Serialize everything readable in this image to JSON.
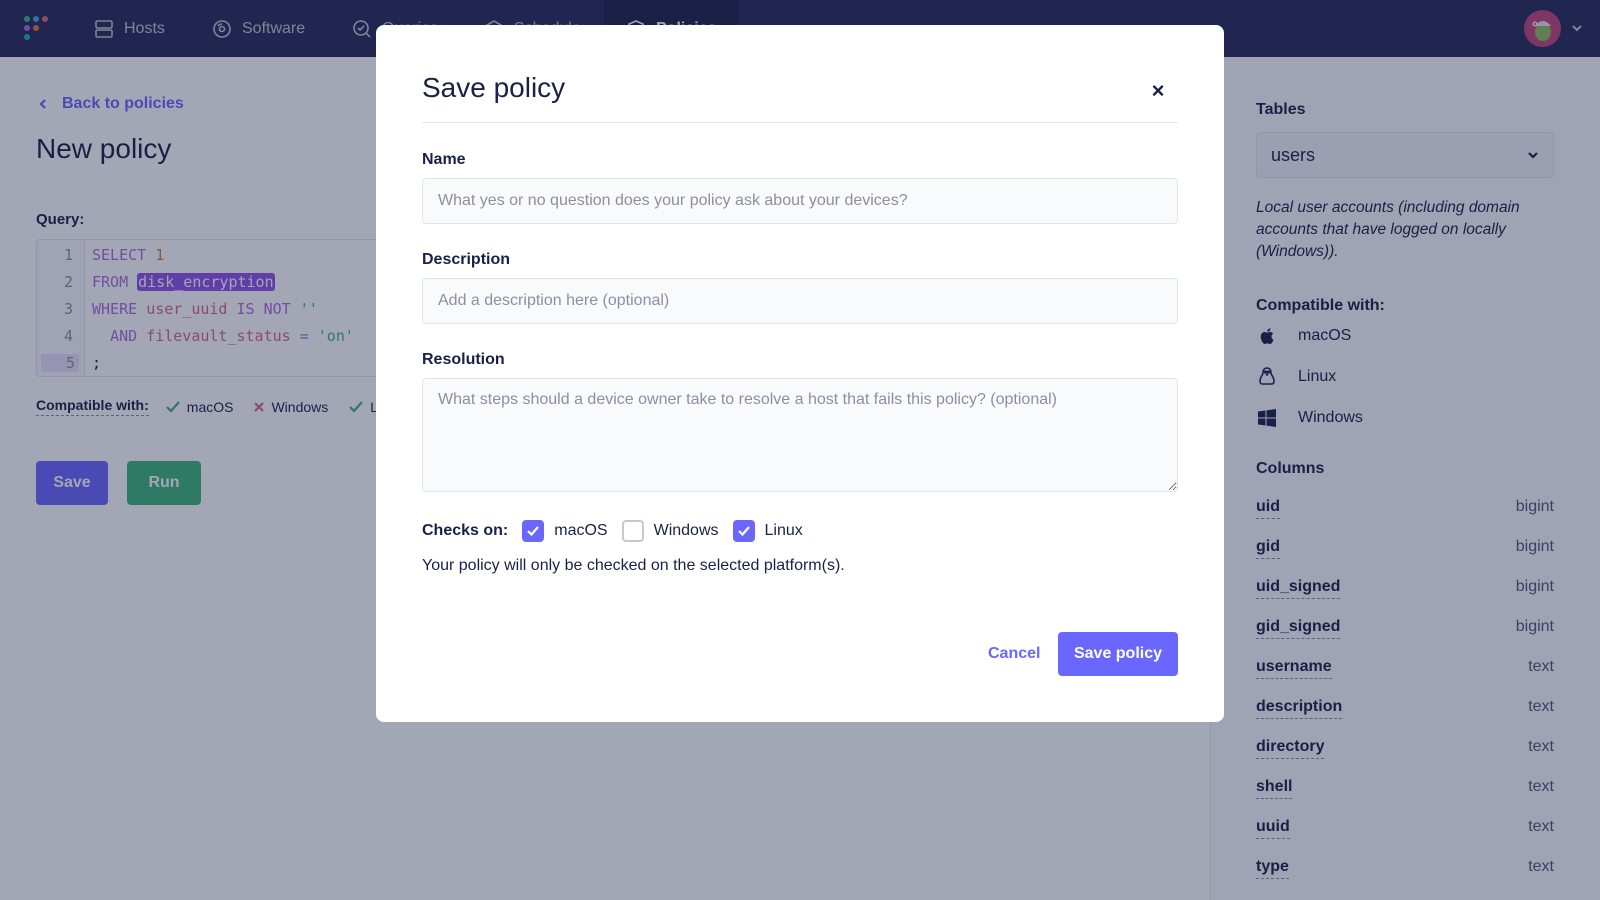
{
  "nav": {
    "items": [
      {
        "label": "Hosts",
        "icon": "hosts-icon"
      },
      {
        "label": "Software",
        "icon": "software-icon"
      },
      {
        "label": "Queries",
        "icon": "queries-icon"
      },
      {
        "label": "Schedule",
        "icon": "schedule-icon"
      },
      {
        "label": "Policies",
        "icon": "policies-icon",
        "active": true
      }
    ],
    "logo_colors": [
      "#3db67b",
      "#4fa3d8",
      "#d66c7b",
      "#ae6ddf",
      "#e07a2c",
      "#1fb5a8"
    ]
  },
  "page": {
    "back_link": "Back to policies",
    "title": "New policy",
    "query_label": "Query:",
    "editor_lines": [
      {
        "num": "1"
      },
      {
        "num": "2"
      },
      {
        "num": "3"
      },
      {
        "num": "4"
      },
      {
        "num": "5"
      }
    ],
    "code": {
      "l1_kw": "SELECT",
      "l1_num": "1",
      "l2_kw": "FROM",
      "l2_table": "disk_encryption",
      "l3_kw": "WHERE",
      "l3_ident": "user_uuid",
      "l3_kw2": "IS NOT",
      "l3_str": "''",
      "l4_kw": "AND",
      "l4_ident": "filevault_status",
      "l4_op": "=",
      "l4_str": "'on'",
      "l5": ";"
    },
    "compatible_label": "Compatible with:",
    "compatible": [
      {
        "name": "macOS",
        "status": "yes"
      },
      {
        "name": "Windows",
        "status": "no"
      },
      {
        "name": "Linux",
        "status": "yes"
      }
    ],
    "save_button": "Save",
    "run_button": "Run"
  },
  "sidebar": {
    "tables_heading": "Tables",
    "selected_table": "users",
    "table_description": "Local user accounts (including domain accounts that have logged on locally (Windows)).",
    "compatible_heading": "Compatible with:",
    "platforms": [
      "macOS",
      "Linux",
      "Windows"
    ],
    "columns_heading": "Columns",
    "columns": [
      {
        "name": "uid",
        "type": "bigint"
      },
      {
        "name": "gid",
        "type": "bigint"
      },
      {
        "name": "uid_signed",
        "type": "bigint"
      },
      {
        "name": "gid_signed",
        "type": "bigint"
      },
      {
        "name": "username",
        "type": "text"
      },
      {
        "name": "description",
        "type": "text"
      },
      {
        "name": "directory",
        "type": "text"
      },
      {
        "name": "shell",
        "type": "text"
      },
      {
        "name": "uuid",
        "type": "text"
      },
      {
        "name": "type",
        "type": "text"
      }
    ]
  },
  "modal": {
    "title": "Save policy",
    "close_icon": "×",
    "name_label": "Name",
    "name_placeholder": "What yes or no question does your policy ask about your devices?",
    "name_value": "",
    "description_label": "Description",
    "description_placeholder": "Add a description here (optional)",
    "description_value": "",
    "resolution_label": "Resolution",
    "resolution_placeholder": "What steps should a device owner take to resolve a host that fails this policy? (optional)",
    "resolution_value": "",
    "checks_label": "Checks on:",
    "checks": [
      {
        "label": "macOS",
        "checked": true
      },
      {
        "label": "Windows",
        "checked": false
      },
      {
        "label": "Linux",
        "checked": true
      }
    ],
    "checks_help": "Your policy will only be checked on the selected platform(s).",
    "cancel_button": "Cancel",
    "save_button": "Save policy"
  },
  "colors": {
    "accent": "#6a67fe",
    "success": "#3db67b",
    "error": "#d66c7b",
    "nav_bg": "#272b58",
    "text": "#192147"
  }
}
